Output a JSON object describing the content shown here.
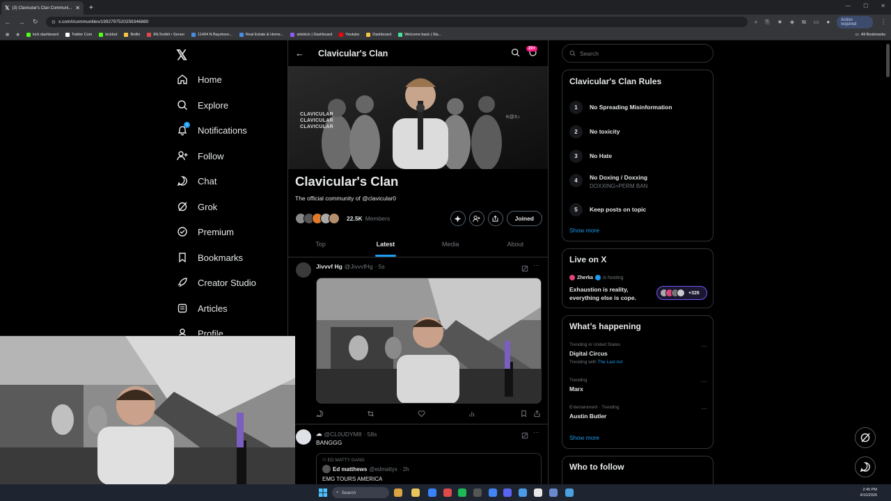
{
  "browser": {
    "tab_title": "(3) Clavicular's Clan Communi...",
    "url": "x.com/i/communities/1992797520259346880",
    "action_required": "Action required",
    "bookmarks": [
      {
        "label": "kick dashboard",
        "color": "#53fc18"
      },
      {
        "label": "Twitter Com",
        "color": "#ffffff"
      },
      {
        "label": "kickbot",
        "color": "#53fc18"
      },
      {
        "label": "Botfix",
        "color": "#f5c542"
      },
      {
        "label": "IRLToolkit • Server",
        "color": "#e24a4a"
      },
      {
        "label": "11404 N Bayshore...",
        "color": "#4a8be2"
      },
      {
        "label": "Real Estate & Home...",
        "color": "#4a8be2"
      },
      {
        "label": "sidekick | Dashboard",
        "color": "#8b5cf6"
      },
      {
        "label": "Youtube",
        "color": "#ff0000"
      },
      {
        "label": "Dashboard",
        "color": "#f5c542"
      },
      {
        "label": "Welcome back | Sla...",
        "color": "#4ae29a"
      }
    ],
    "all_bookmarks": "All Bookmarks"
  },
  "nav": {
    "items": [
      {
        "label": "Home",
        "icon": "home-icon"
      },
      {
        "label": "Explore",
        "icon": "search-icon"
      },
      {
        "label": "Notifications",
        "icon": "bell-icon",
        "badge": "3"
      },
      {
        "label": "Follow",
        "icon": "follow-icon"
      },
      {
        "label": "Chat",
        "icon": "chat-icon"
      },
      {
        "label": "Grok",
        "icon": "grok-icon"
      },
      {
        "label": "Premium",
        "icon": "premium-icon"
      },
      {
        "label": "Bookmarks",
        "icon": "bookmark-icon"
      },
      {
        "label": "Creator Studio",
        "icon": "rocket-icon"
      },
      {
        "label": "Articles",
        "icon": "articles-icon"
      },
      {
        "label": "Profile",
        "icon": "profile-icon"
      }
    ]
  },
  "community": {
    "header_title": "Clavicular's Clan",
    "notif_badge": "20+",
    "banner_text": [
      "CLAVICULAR",
      "CLAVICULAR",
      "CLAVICULAR"
    ],
    "banner_badge": "K@X♪",
    "name": "Clavicular's Clan",
    "description": "The official community of @clavicular0",
    "members_count": "22.5K",
    "members_label": "Members",
    "joined_label": "Joined",
    "tabs": [
      "Top",
      "Latest",
      "Media",
      "About"
    ],
    "active_tab": "Latest"
  },
  "posts": [
    {
      "name": "Jivvvf Hg",
      "handle": "@JivvvfHg",
      "time": "· 5s"
    },
    {
      "name": "☁",
      "handle": "@CL0UDYM8",
      "time": "· 58s",
      "text": "BANGGG",
      "quote": {
        "context": "ED MATTY GANG",
        "name": "Ed matthews",
        "handle": "@edmattyx",
        "time": "· 2h",
        "text": "EMG TOURS AMERICA"
      }
    }
  ],
  "right": {
    "search_placeholder": "Search",
    "rules_title": "Clavicular's Clan Rules",
    "rules": [
      {
        "num": "1",
        "title": "No Spreading Misinformation",
        "sub": ""
      },
      {
        "num": "2",
        "title": "No toxicity",
        "sub": ""
      },
      {
        "num": "3",
        "title": "No Hate",
        "sub": ""
      },
      {
        "num": "4",
        "title": "No Doxing / Doxxing",
        "sub": "DOXXING=PERM BAN"
      },
      {
        "num": "5",
        "title": "Keep posts on topic",
        "sub": ""
      }
    ],
    "show_more": "Show more",
    "live_title": "Live on X",
    "live_host": "Zherka",
    "live_hosting": "is hosting",
    "live_space": "Exhaustion is reality, everything else is cope.",
    "live_count": "+326",
    "happening_title": "What’s happening",
    "trends": [
      {
        "context": "Trending in United States",
        "name": "Digital Circus",
        "with_label": "Trending with",
        "with_link": "The Last Act"
      },
      {
        "context": "Trending",
        "name": "Marx"
      },
      {
        "context": "Entertainment · Trending",
        "name": "Austin Butler"
      }
    ],
    "trends_show_more": "Show more",
    "follow_title": "Who to follow"
  },
  "taskbar": {
    "search": "Search",
    "time": "2:45 PM",
    "date": "4/10/2026"
  }
}
